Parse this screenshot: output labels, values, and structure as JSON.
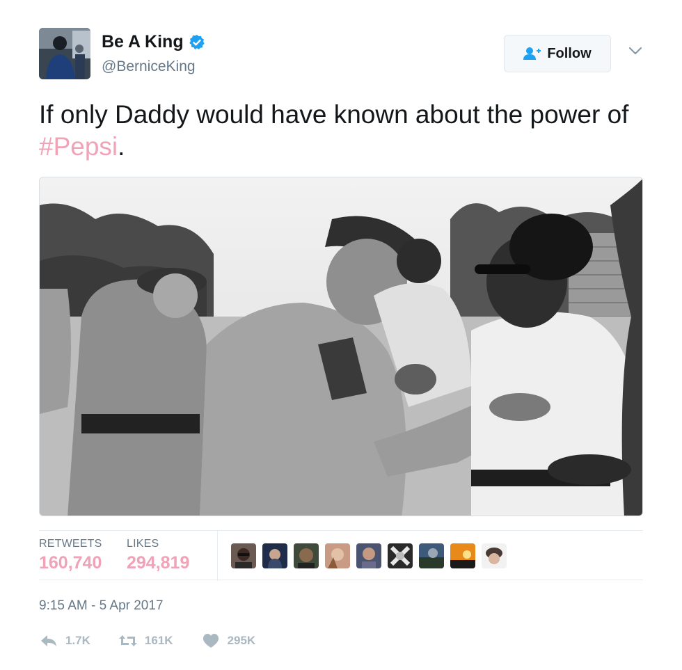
{
  "user": {
    "display_name": "Be A King",
    "handle": "@BerniceKing",
    "verified_icon": "verified-badge-icon",
    "avatar_icon": "avatar"
  },
  "follow_button": {
    "label": "Follow",
    "icon": "add-user-icon"
  },
  "menu": {
    "icon": "chevron-down-icon"
  },
  "tweet": {
    "text_before": "If only Daddy would have known about the power of ",
    "hashtag": "#Pepsi",
    "text_after": "."
  },
  "media": {
    "type": "black-and-white photo"
  },
  "stats": {
    "retweets_label": "RETWEETS",
    "retweets_value": "160,740",
    "likes_label": "LIKES",
    "likes_value": "294,819"
  },
  "timestamp": "9:15 AM - 5 Apr 2017",
  "actions": [
    {
      "name": "reply",
      "icon": "reply-icon",
      "count": "1.7K"
    },
    {
      "name": "retweet",
      "icon": "retweet-icon",
      "count": "161K"
    },
    {
      "name": "like",
      "icon": "heart-icon",
      "count": "295K"
    }
  ],
  "colors": {
    "accent_pink": "#f0a3b6",
    "secondary_text": "#657786",
    "action_gray": "#aab8c2",
    "verified_blue": "#1da1f2"
  }
}
